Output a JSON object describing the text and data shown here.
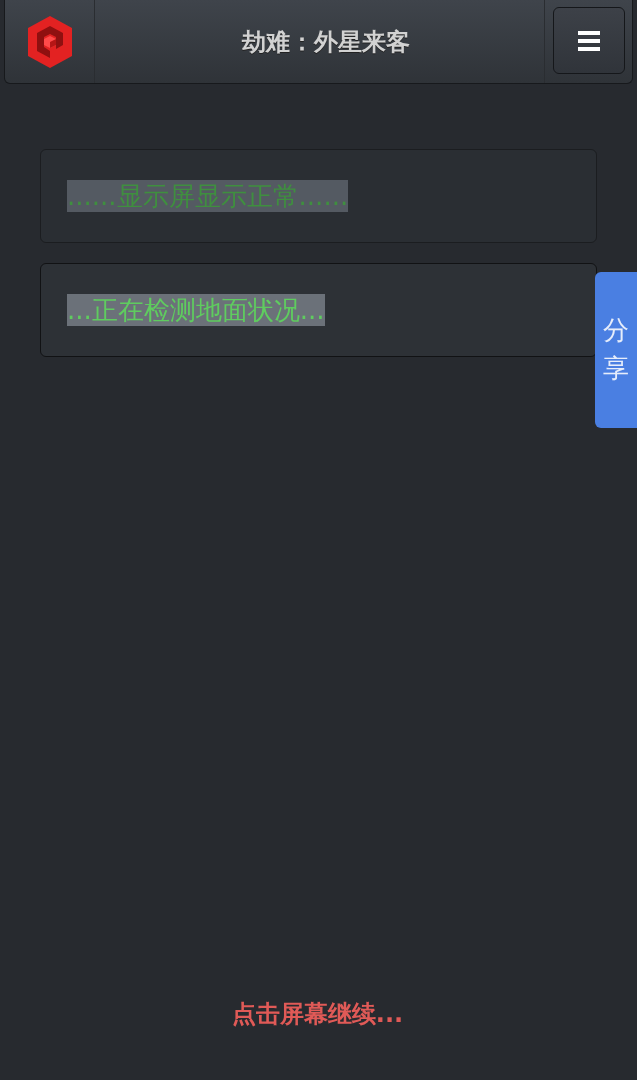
{
  "header": {
    "title": "劫难：外星来客"
  },
  "messages": [
    {
      "text": "......显示屏显示正常......",
      "dimmed": true
    },
    {
      "text": "...正在检测地面状况...",
      "dimmed": false
    }
  ],
  "share_tab": {
    "label": "分享"
  },
  "footer": {
    "prompt": "点击屏幕继续..."
  }
}
